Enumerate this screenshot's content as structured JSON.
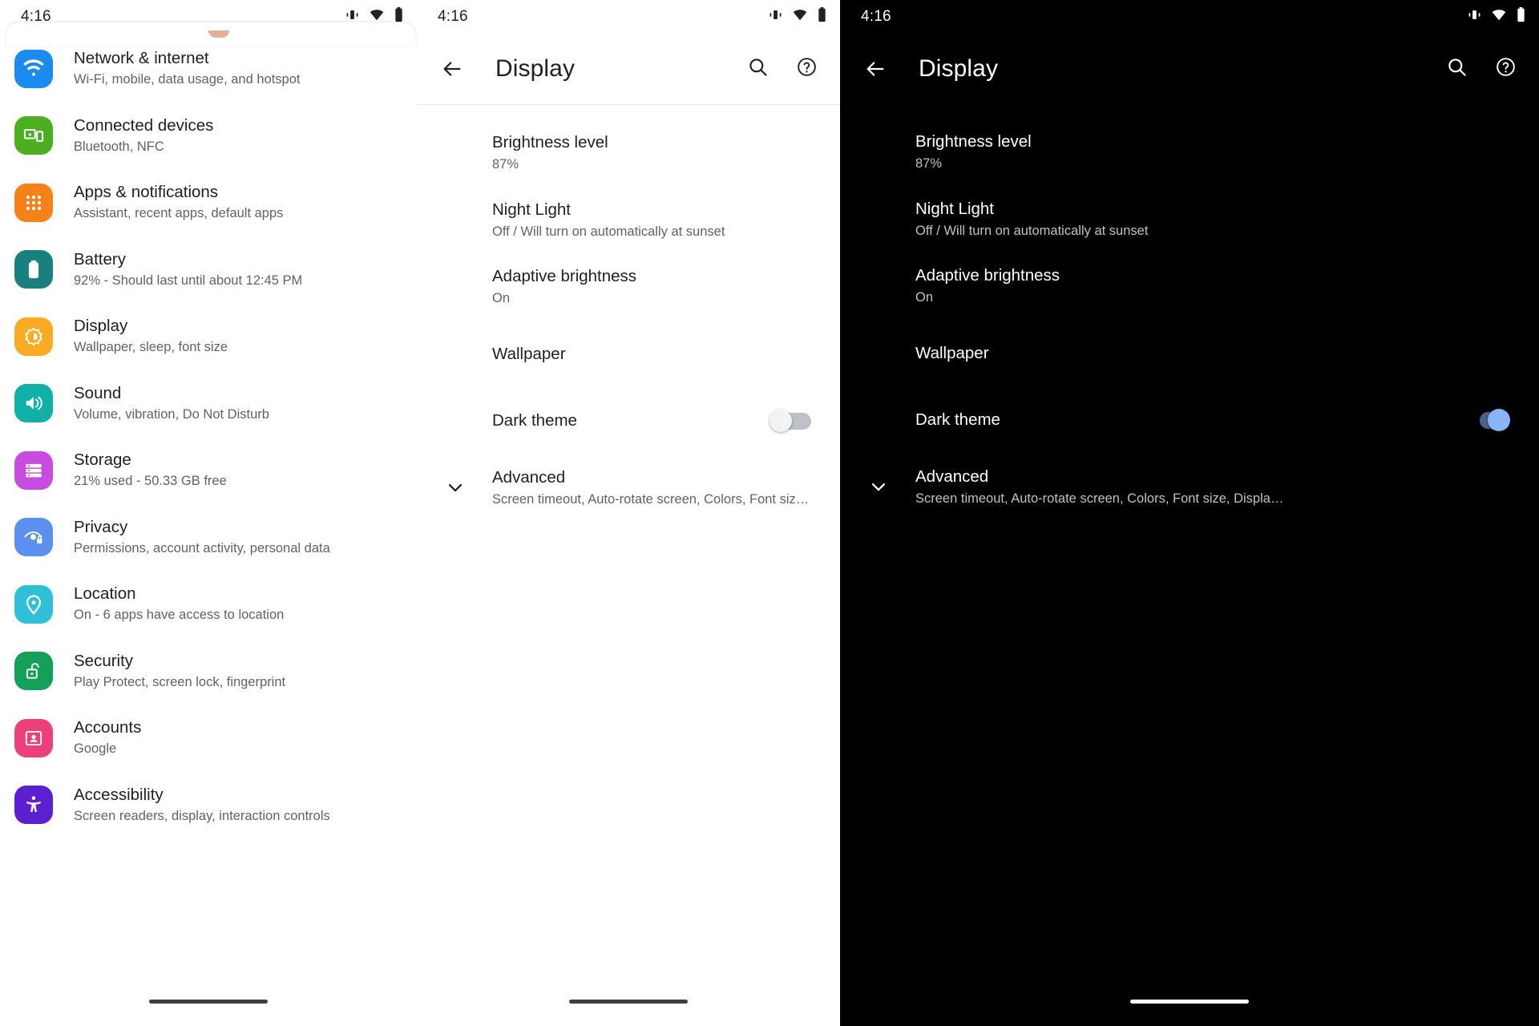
{
  "status_bar": {
    "time": "4:16",
    "icons": [
      "vibrate-icon",
      "wifi-icon",
      "battery-icon"
    ]
  },
  "settings_panel": {
    "items": [
      {
        "icon": "wifi-icon",
        "color": "#1a8cf0",
        "title": "Network & internet",
        "subtitle": "Wi-Fi, mobile, data usage, and hotspot"
      },
      {
        "icon": "devices-icon",
        "color": "#4caf20",
        "title": "Connected devices",
        "subtitle": "Bluetooth, NFC"
      },
      {
        "icon": "apps-grid-icon",
        "color": "#f68118",
        "title": "Apps & notifications",
        "subtitle": "Assistant, recent apps, default apps"
      },
      {
        "icon": "battery-icon",
        "color": "#1a7f7f",
        "title": "Battery",
        "subtitle": "92% - Should last until about 12:45 PM"
      },
      {
        "icon": "brightness-icon",
        "color": "#f9ab23",
        "title": "Display",
        "subtitle": "Wallpaper, sleep, font size"
      },
      {
        "icon": "volume-icon",
        "color": "#10b0a8",
        "title": "Sound",
        "subtitle": "Volume, vibration, Do Not Disturb"
      },
      {
        "icon": "storage-icon",
        "color": "#c84ce0",
        "title": "Storage",
        "subtitle": "21% used - 50.33 GB free"
      },
      {
        "icon": "eye-lock-icon",
        "color": "#5b8ff0",
        "title": "Privacy",
        "subtitle": "Permissions, account activity, personal data"
      },
      {
        "icon": "location-pin-icon",
        "color": "#2fc0d8",
        "title": "Location",
        "subtitle": "On - 6 apps have access to location"
      },
      {
        "icon": "unlock-icon",
        "color": "#15a05a",
        "title": "Security",
        "subtitle": "Play Protect, screen lock, fingerprint"
      },
      {
        "icon": "account-card-icon",
        "color": "#ec407a",
        "title": "Accounts",
        "subtitle": "Google"
      },
      {
        "icon": "accessibility-icon",
        "color": "#5b21d0",
        "title": "Accessibility",
        "subtitle": "Screen readers, display, interaction controls"
      }
    ]
  },
  "display_light": {
    "appbar": {
      "title": "Display",
      "back_icon": "arrow-back-icon",
      "search_icon": "search-icon",
      "help_icon": "help-circle-icon"
    },
    "rows": [
      {
        "title": "Brightness level",
        "subtitle": "87%"
      },
      {
        "title": "Night Light",
        "subtitle": "Off / Will turn on automatically at sunset"
      },
      {
        "title": "Adaptive brightness",
        "subtitle": "On"
      },
      {
        "title": "Wallpaper",
        "subtitle": ""
      },
      {
        "title": "Dark theme",
        "subtitle": "",
        "toggle": "off"
      },
      {
        "title": "Advanced",
        "subtitle": "Screen timeout, Auto-rotate screen, Colors, Font size, Displa…",
        "expander": "chevron-down-icon"
      }
    ],
    "theme": "light"
  },
  "display_dark": {
    "appbar": {
      "title": "Display",
      "back_icon": "arrow-back-icon",
      "search_icon": "search-icon",
      "help_icon": "help-circle-icon"
    },
    "rows": [
      {
        "title": "Brightness level",
        "subtitle": "87%"
      },
      {
        "title": "Night Light",
        "subtitle": "Off / Will turn on automatically at sunset"
      },
      {
        "title": "Adaptive brightness",
        "subtitle": "On"
      },
      {
        "title": "Wallpaper",
        "subtitle": ""
      },
      {
        "title": "Dark theme",
        "subtitle": "",
        "toggle": "on"
      },
      {
        "title": "Advanced",
        "subtitle": "Screen timeout, Auto-rotate screen, Colors, Font size, Displa…",
        "expander": "chevron-down-icon"
      }
    ],
    "theme": "dark"
  },
  "colors": {
    "accent_blue": "#8ab4f8",
    "light_bg": "#ffffff",
    "dark_bg": "#000000",
    "light_primary_text": "#202124",
    "light_secondary_text": "#5f6368",
    "dark_primary_text": "#ffffff",
    "dark_secondary_text": "#bdc1c6"
  }
}
